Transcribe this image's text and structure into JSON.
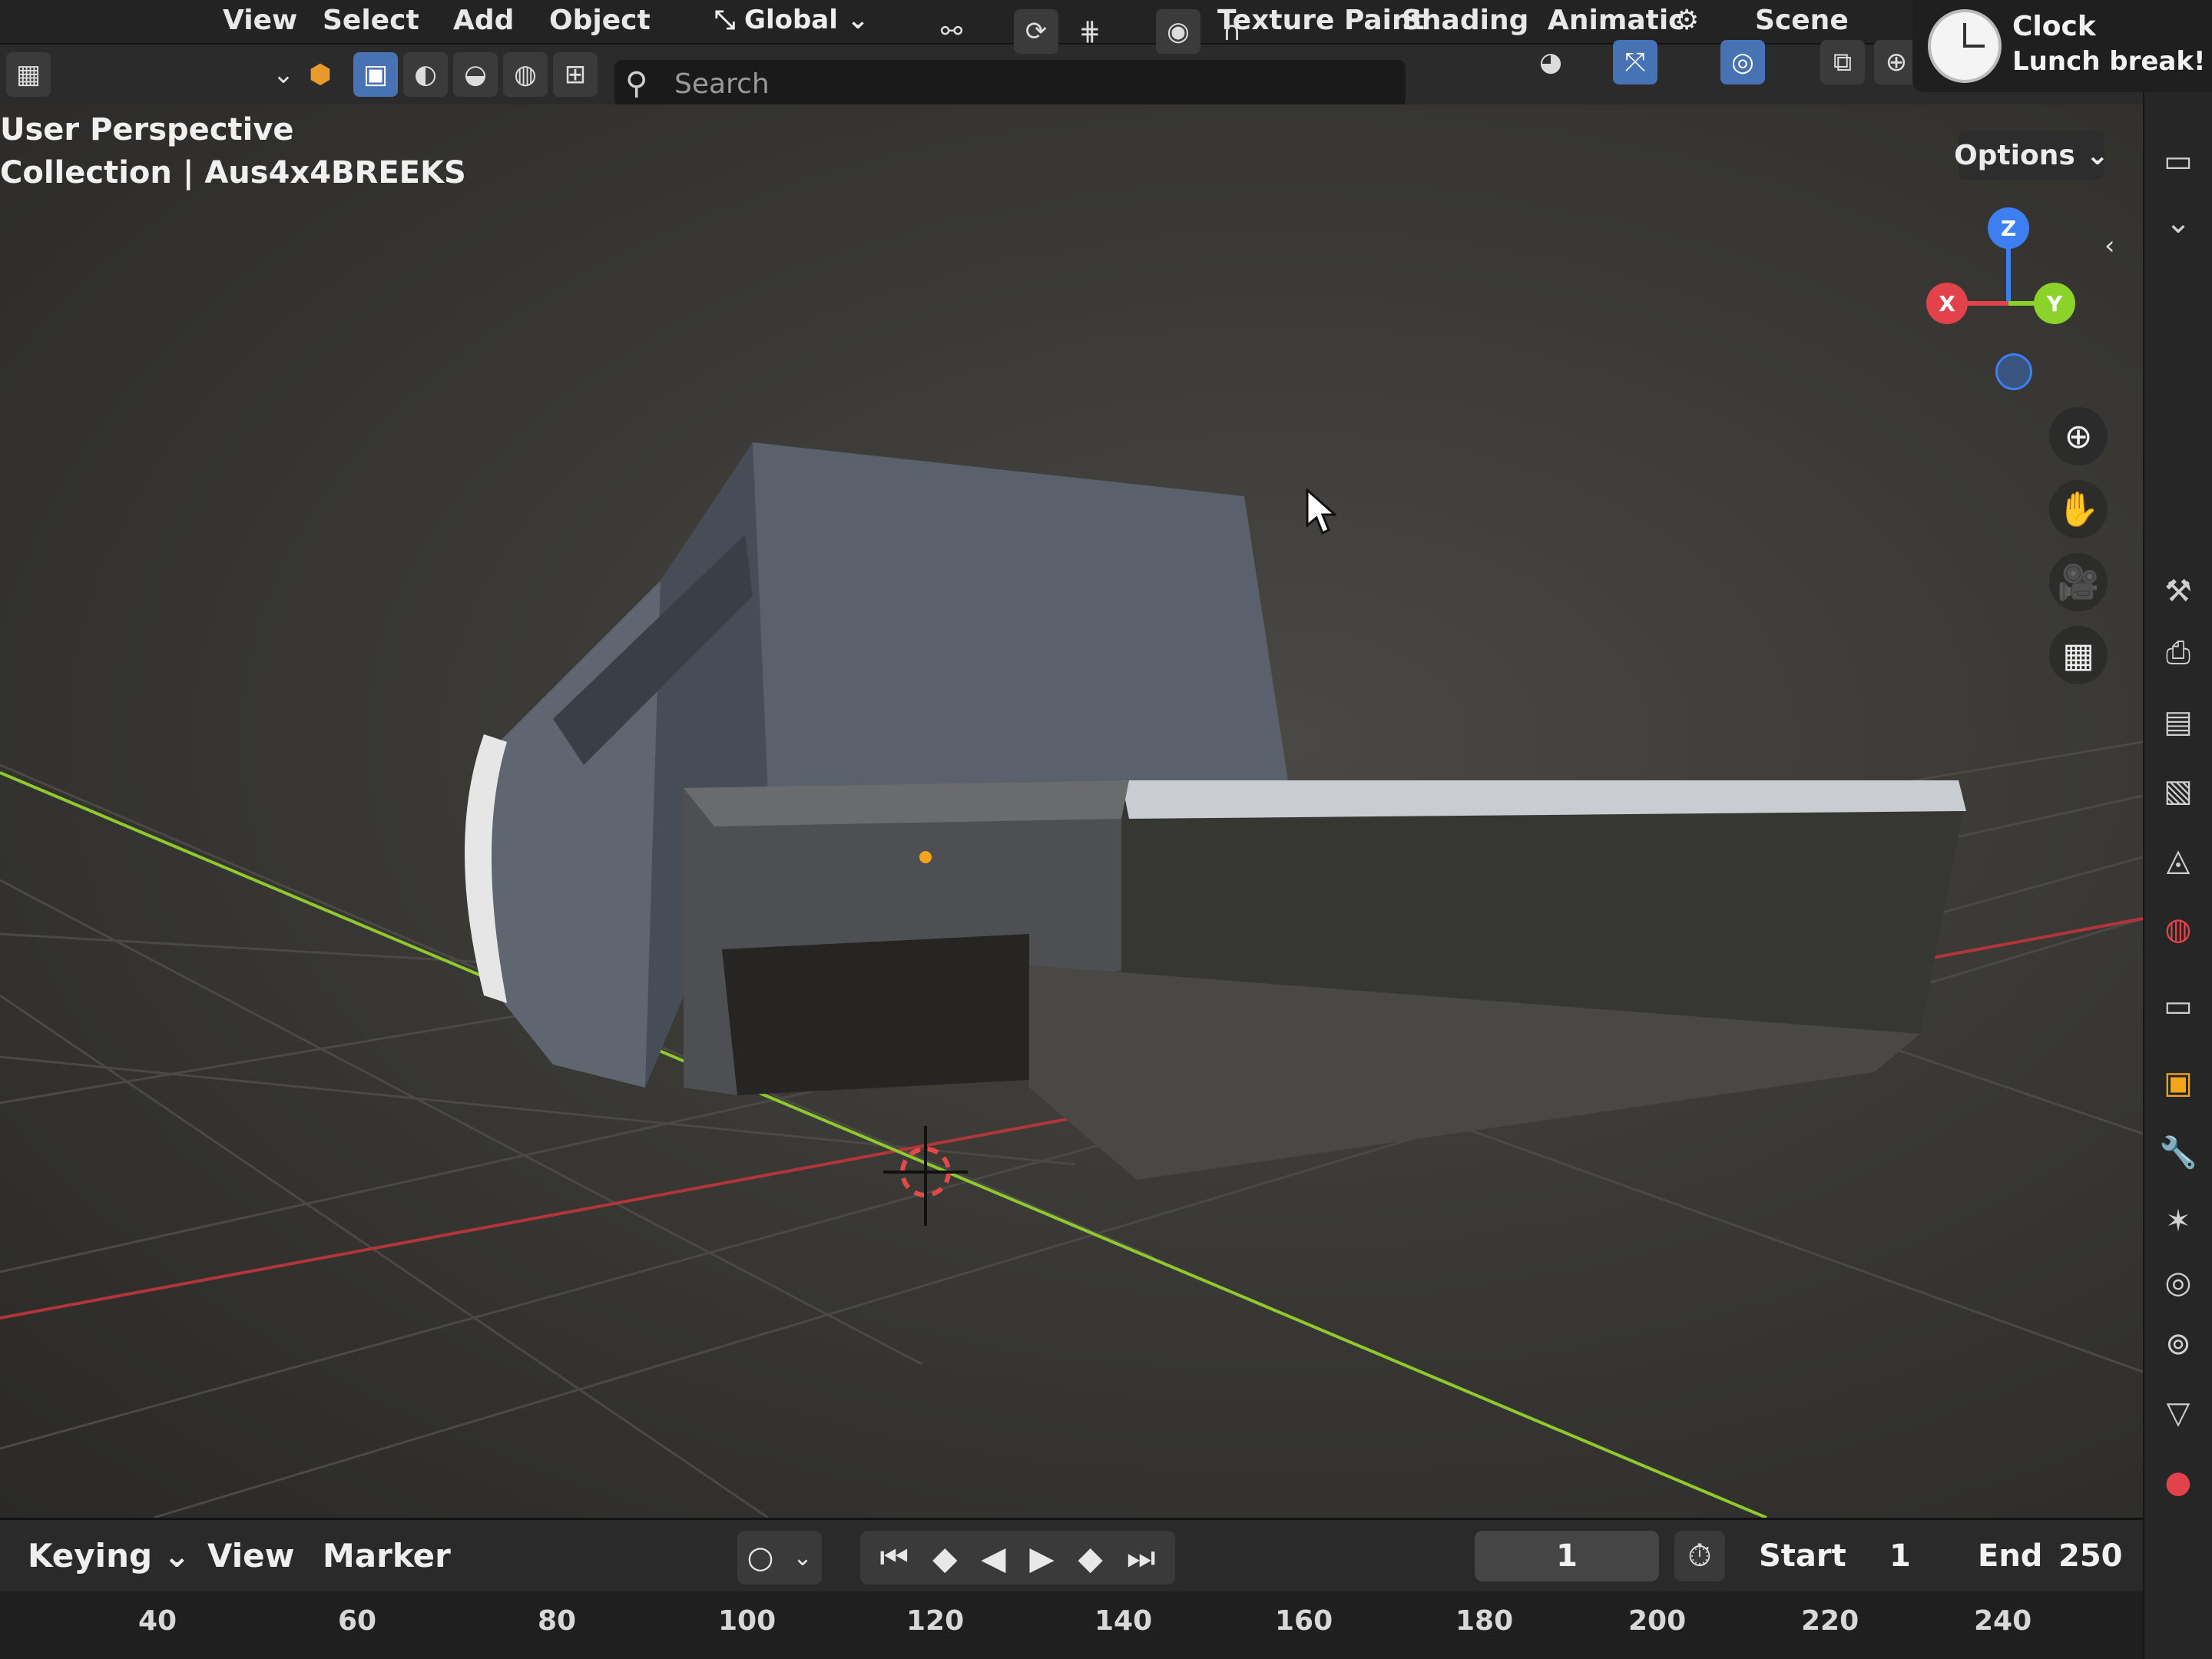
{
  "top_menu": {
    "items": [
      "View",
      "Select",
      "Add",
      "Object"
    ],
    "workspace_tabs": [
      "Texture Paint",
      "Shading",
      "Animatic"
    ],
    "scene_label": "Scene"
  },
  "transform": {
    "orientation": "Global"
  },
  "header_toolbar": {
    "search_placeholder": "Search"
  },
  "viewport": {
    "view_name": "User Perspective",
    "collection_path": "Collection | Aus4x4BREEKS",
    "options_label": "Options",
    "gizmo_axes": [
      "X",
      "Y",
      "Z"
    ]
  },
  "clock_widget": {
    "title": "Clock",
    "message": "Lunch break!"
  },
  "timeline": {
    "menu": [
      "Keying",
      "View",
      "Marker"
    ],
    "current_frame": "1",
    "start_label": "Start",
    "start_value": "1",
    "end_label": "End",
    "end_value": "250",
    "ruler_ticks": [
      "40",
      "60",
      "80",
      "100",
      "120",
      "140",
      "160",
      "180",
      "200",
      "220",
      "240"
    ]
  },
  "colors": {
    "accent": "#4772b3",
    "x_axis": "#e2434b",
    "y_axis": "#8bd22a",
    "z_axis": "#3d7ff0"
  }
}
